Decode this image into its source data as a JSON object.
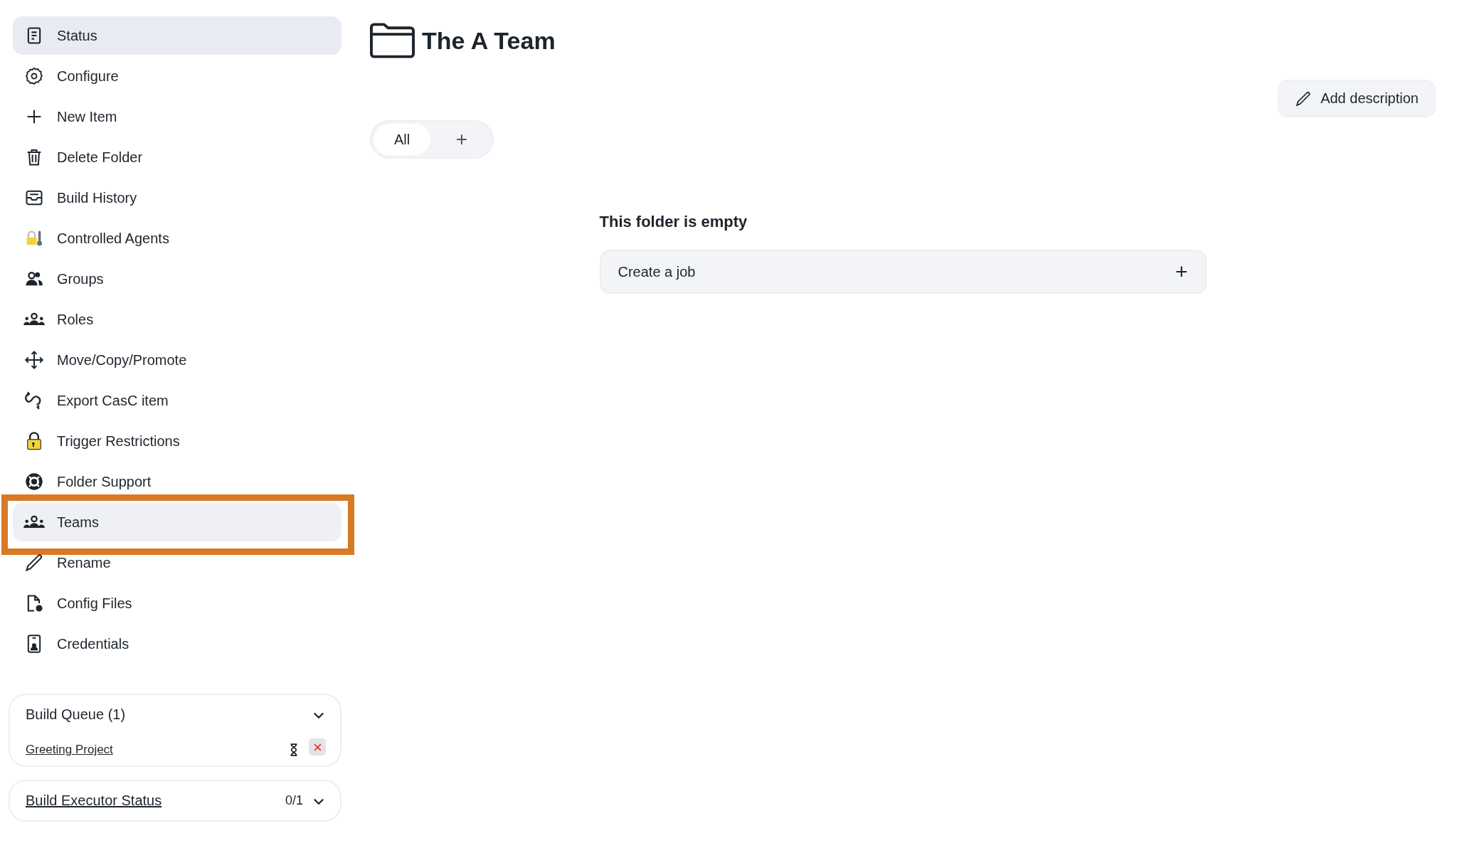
{
  "sidebar": {
    "items": [
      {
        "label": "Status",
        "selected": true,
        "annotated": false
      },
      {
        "label": "Configure",
        "selected": false,
        "annotated": false
      },
      {
        "label": "New Item",
        "selected": false,
        "annotated": false
      },
      {
        "label": "Delete Folder",
        "selected": false,
        "annotated": false
      },
      {
        "label": "Build History",
        "selected": false,
        "annotated": false
      },
      {
        "label": "Controlled Agents",
        "selected": false,
        "annotated": false
      },
      {
        "label": "Groups",
        "selected": false,
        "annotated": false
      },
      {
        "label": "Roles",
        "selected": false,
        "annotated": false
      },
      {
        "label": "Move/Copy/Promote",
        "selected": false,
        "annotated": false
      },
      {
        "label": "Export CasC item",
        "selected": false,
        "annotated": false
      },
      {
        "label": "Trigger Restrictions",
        "selected": false,
        "annotated": false
      },
      {
        "label": "Folder Support",
        "selected": false,
        "annotated": false
      },
      {
        "label": "Teams",
        "selected": true,
        "annotated": true
      },
      {
        "label": "Rename",
        "selected": false,
        "annotated": false
      },
      {
        "label": "Config Files",
        "selected": false,
        "annotated": false
      },
      {
        "label": "Credentials",
        "selected": false,
        "annotated": false
      }
    ]
  },
  "build_queue": {
    "title": "Build Queue (1)",
    "expanded": true,
    "items": [
      {
        "name": "Greeting Project"
      }
    ]
  },
  "executor_status": {
    "title": "Build Executor Status",
    "count": "0/1",
    "expanded": true
  },
  "page": {
    "title": "The A Team",
    "add_description": "Add description",
    "tabs": [
      {
        "label": "All",
        "selected": true
      }
    ],
    "add_tab": "+",
    "empty_heading": "This folder is empty",
    "create_job": "Create a job",
    "create_icon": "+"
  }
}
